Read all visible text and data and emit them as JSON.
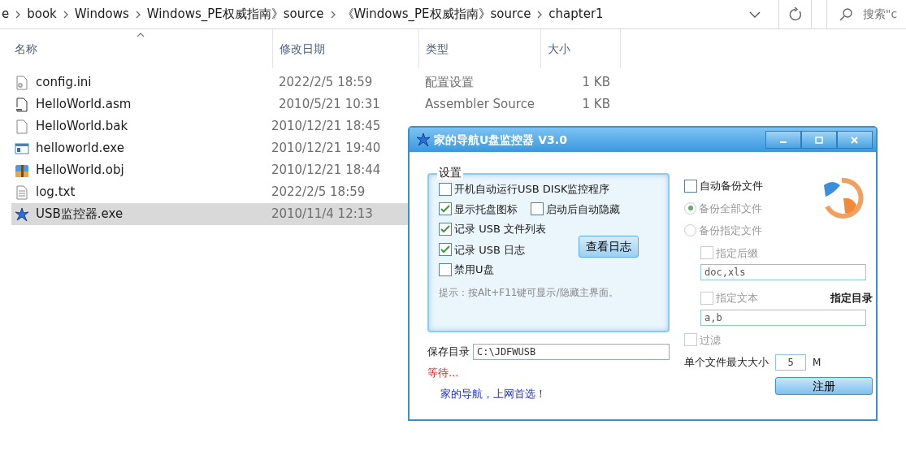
{
  "address_bar": {
    "segments": [
      "e",
      "book",
      "Windows",
      "Windows_PE权威指南》source",
      "《Windows_PE权威指南》source",
      "chapter1"
    ]
  },
  "search": {
    "placeholder": "搜索\"c"
  },
  "columns": [
    {
      "label": "名称"
    },
    {
      "label": "修改日期"
    },
    {
      "label": "类型"
    },
    {
      "label": "大小"
    }
  ],
  "files": [
    {
      "kind": "settings",
      "name": "config.ini",
      "date": "2022/2/5 18:59",
      "type": "配置设置",
      "size": "1 KB",
      "selected": false
    },
    {
      "kind": "asm",
      "name": "HelloWorld.asm",
      "date": "2010/5/21 10:31",
      "type": "Assembler Source",
      "size": "1 KB",
      "selected": false
    },
    {
      "kind": "blank",
      "name": "HelloWorld.bak",
      "date": "2010/12/21 18:45",
      "selected": false
    },
    {
      "kind": "exe",
      "name": "helloworld.exe",
      "date": "2010/12/21 19:40",
      "selected": false
    },
    {
      "kind": "archive",
      "name": "HelloWorld.obj",
      "date": "2010/12/21 18:44",
      "selected": false
    },
    {
      "kind": "text",
      "name": "log.txt",
      "date": "2022/2/5 18:59",
      "selected": false
    },
    {
      "kind": "star",
      "name": "USB监控器.exe",
      "date": "2010/11/4 12:13",
      "selected": true
    }
  ],
  "dialog": {
    "title": "家的导航U盘监控器 V3.0",
    "group_title": "设置",
    "options": [
      {
        "label": "开机自动运行USB DISK监控程序",
        "checked": false
      },
      {
        "label": "显示托盘图标",
        "checked": true
      },
      {
        "label": "启动后自动隐藏",
        "checked": false
      },
      {
        "label": "记录 USB 文件列表",
        "checked": true
      },
      {
        "label": "记录 USB 日志",
        "checked": true
      },
      {
        "label": "禁用U盘",
        "checked": false
      }
    ],
    "view_log_button": "查看日志",
    "hint": "提示：按Alt+F11键可显示/隐藏主界面。",
    "save_dir_label": "保存目录",
    "save_dir_value": "C:\\JDFWUSB",
    "status": "等待...",
    "slogan": "家的导航，上网首选！",
    "backup": {
      "label": "自动备份文件",
      "checked": false
    },
    "backup_modes": [
      {
        "label": "备份全部文件",
        "selected": true,
        "disabled": true
      },
      {
        "label": "备份指定文件",
        "selected": false,
        "disabled": true
      }
    ],
    "suffix": {
      "label": "指定后缀",
      "checked": false,
      "disabled": true,
      "value": "doc,xls"
    },
    "text_filter": {
      "label": "指定文本",
      "checked": false,
      "disabled": true,
      "value": "a,b"
    },
    "dir_label": "指定目录",
    "filter": {
      "label": "过滤",
      "checked": false,
      "disabled": true
    },
    "max_size_label": "单个文件最大大小",
    "max_size_value": "5",
    "max_size_unit": "M",
    "register_button": "注册"
  }
}
